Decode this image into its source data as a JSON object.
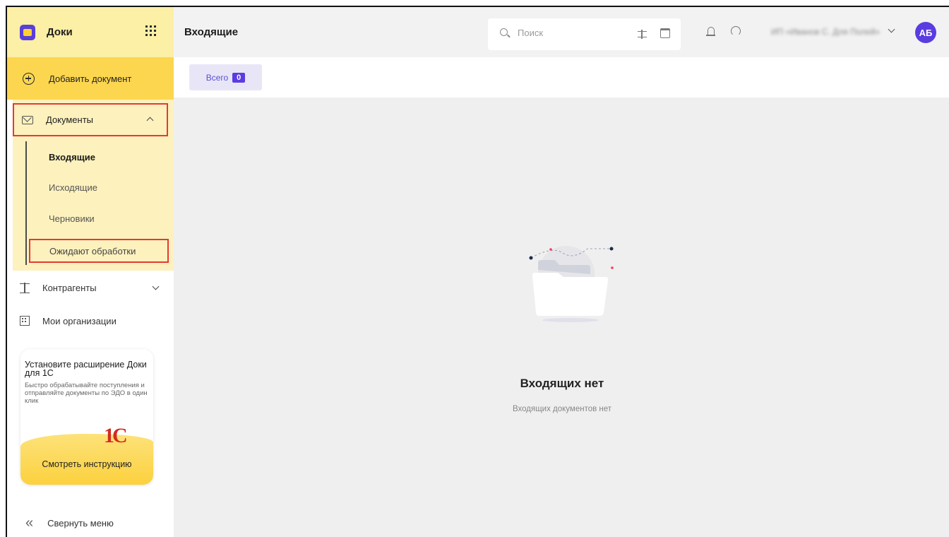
{
  "app": {
    "name": "Доки"
  },
  "sidebar": {
    "add_document": "Добавить документ",
    "documents": {
      "label": "Документы",
      "items": [
        {
          "label": "Входящие",
          "active": true
        },
        {
          "label": "Исходящие",
          "active": false
        },
        {
          "label": "Черновики",
          "active": false
        },
        {
          "label": "Ожидают обработки",
          "active": false
        }
      ]
    },
    "counterparties": "Контрагенты",
    "my_organizations": "Мои организации",
    "promo": {
      "title": "Установите расширение Доки для 1С",
      "text": "Быстро обрабатывайте поступления и отправляйте документы по ЭДО в один клик",
      "logo": "1С",
      "button": "Смотреть инструкцию"
    },
    "collapse": "Свернуть меню"
  },
  "header": {
    "title": "Входящие",
    "search": {
      "placeholder": "Поиск",
      "value": ""
    },
    "user": {
      "name": "ИП «Иванов С. Для Полей»",
      "initials": "АБ"
    }
  },
  "filters": {
    "tabs": [
      {
        "label": "Всего",
        "count": "0"
      }
    ]
  },
  "empty_state": {
    "title": "Входящих нет",
    "subtitle": "Входящих документов нет"
  },
  "colors": {
    "brand_purple": "#5b3ce0",
    "sidebar_yellow": "#fcd64f",
    "sidebar_light": "#fdf1bd",
    "highlight_red": "#e53935",
    "logo_red": "#d22b1f"
  },
  "icons": [
    "docs-logo-icon",
    "apps-grid-icon",
    "plus-circle-icon",
    "envelope-icon",
    "chevron-up-icon",
    "counterparties-icon",
    "chevron-down-icon",
    "building-icon",
    "double-chevron-left-icon",
    "search-icon",
    "filter-icon",
    "calendar-icon",
    "bell-icon",
    "headset-icon"
  ]
}
